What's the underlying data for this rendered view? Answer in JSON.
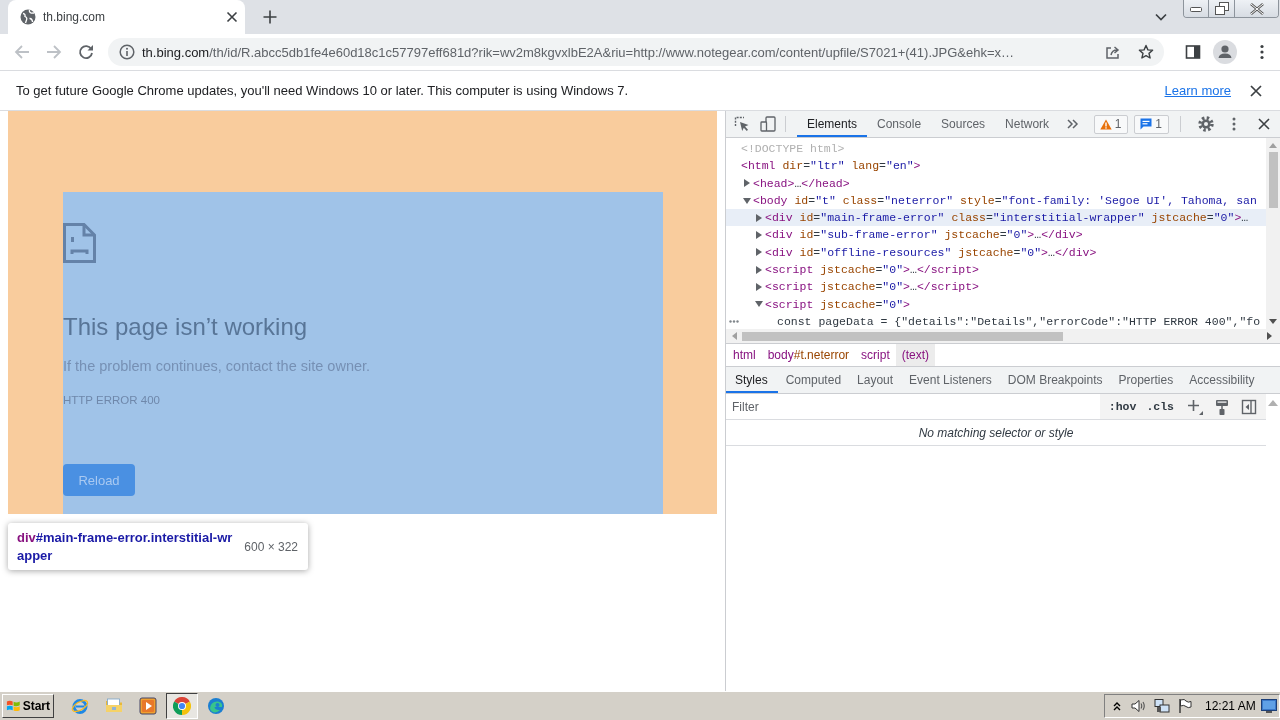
{
  "browser": {
    "tab": {
      "title": "th.bing.com"
    },
    "nav_buttons": [
      {
        "kind": "back",
        "disabled": true
      },
      {
        "kind": "forward",
        "disabled": true
      },
      {
        "kind": "reload",
        "disabled": false
      }
    ],
    "address_bar": {
      "host": "th.bing.com",
      "path": "/th/id/R.abcc5db1fe4e60d18c1c57797eff681d?rik=wv2m8kgvxlbE2A&riu=http://www.notegear.com/content/upfile/S7021+(41).JPG&ehk=x…"
    }
  },
  "infobar": {
    "message": "To get future Google Chrome updates, you'll need Windows 10 or later. This computer is using Windows 7.",
    "link": "Learn more"
  },
  "page": {
    "title": "This page isn’t working",
    "message": "If the problem continues, contact the site owner.",
    "error_code": "HTTP ERROR 400",
    "button": "Reload"
  },
  "inspect_tooltip": {
    "tag": "div",
    "selector": "#main-frame-error.interstitial-wrapper",
    "size": "600 × 322"
  },
  "devtools": {
    "tabs": [
      {
        "label": "Elements",
        "selected": true
      },
      {
        "label": "Console",
        "selected": false
      },
      {
        "label": "Sources",
        "selected": false
      },
      {
        "label": "Network",
        "selected": false
      }
    ],
    "issues": [
      {
        "kind": "warning",
        "count": "1"
      },
      {
        "kind": "message",
        "count": "1"
      }
    ],
    "dom_tree": [
      {
        "kind": "doctype",
        "text": "<!DOCTYPE html>"
      },
      {
        "kind": "element",
        "text": "<html dir=\"ltr\" lang=\"en\">",
        "children": [
          {
            "kind": "element",
            "text": "<head>…</head>",
            "expanded": false
          },
          {
            "kind": "element",
            "text": "<body id=\"t\" class=\"neterror\" style=\"font-family: 'Segoe UI', Tahoma, san",
            "expanded": true,
            "children": [
              {
                "kind": "element",
                "text": "<div id=\"main-frame-error\" class=\"interstitial-wrapper\" jstcache=\"0\">…",
                "expanded": false,
                "hovered": true
              },
              {
                "kind": "element",
                "text": "<div id=\"sub-frame-error\" jstcache=\"0\">…</div>",
                "expanded": false,
                "hovered": false
              },
              {
                "kind": "element",
                "text": "<div id=\"offline-resources\" jstcache=\"0\">…</div>",
                "expanded": false,
                "hovered": false
              },
              {
                "kind": "element",
                "text": "<script jstcache=\"0\">…</script>",
                "expanded": false,
                "hovered": false
              },
              {
                "kind": "element",
                "text": "<script jstcache=\"0\">…</script>",
                "expanded": false,
                "hovered": false
              },
              {
                "kind": "element",
                "text": "<script jstcache=\"0\">",
                "expanded": true,
                "hovered": false,
                "children": [
                  {
                    "kind": "text",
                    "text": "const pageData = {\"details\":\"Details\",\"errorCode\":\"HTTP ERROR 400\",\"fo",
                    "selected": true
                  }
                ]
              }
            ]
          }
        ]
      }
    ],
    "breadcrumbs": [
      {
        "tag": "html",
        "selected": false
      },
      {
        "tag": "body",
        "id_class": "#t.neterror",
        "selected": false
      },
      {
        "tag": "script",
        "selected": false
      },
      {
        "tag": "(text)",
        "selected": true
      }
    ],
    "sidebar_tabs": [
      {
        "label": "Styles",
        "selected": true
      },
      {
        "label": "Computed",
        "selected": false
      },
      {
        "label": "Layout",
        "selected": false
      },
      {
        "label": "Event Listeners",
        "selected": false
      },
      {
        "label": "DOM Breakpoints",
        "selected": false
      },
      {
        "label": "Properties",
        "selected": false
      },
      {
        "label": "Accessibility",
        "selected": false
      }
    ],
    "filter": {
      "placeholder": "Filter"
    },
    "filter_buttons": [
      ":hov",
      ".cls"
    ],
    "empty_message": "No matching selector or style"
  },
  "taskbar": {
    "start": "Start",
    "apps": [
      {
        "kind": "ie",
        "active": false
      },
      {
        "kind": "folder",
        "active": false
      },
      {
        "kind": "media",
        "active": false
      },
      {
        "kind": "chrome",
        "active": true
      },
      {
        "kind": "edge",
        "active": false
      }
    ],
    "clock": "12:21 AM"
  }
}
